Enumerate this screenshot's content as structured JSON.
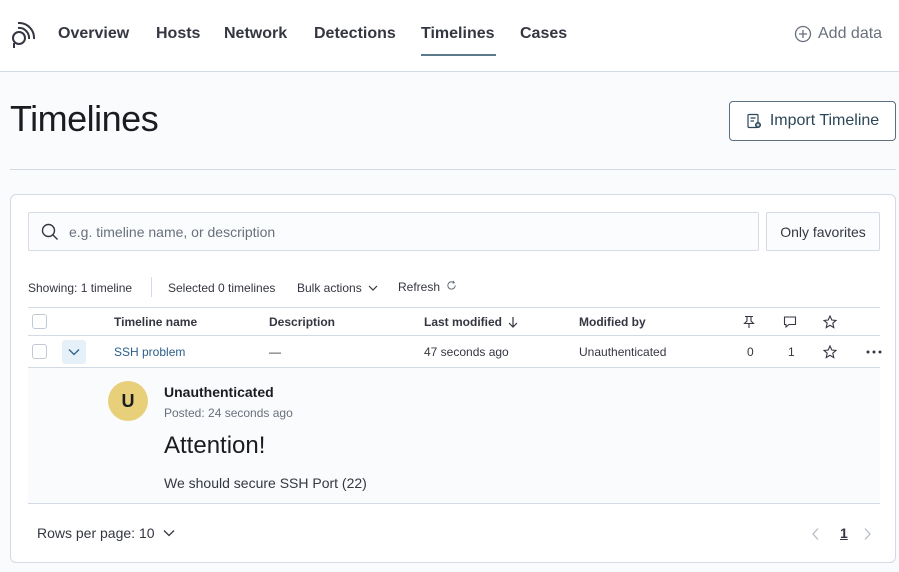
{
  "nav": {
    "tabs": [
      {
        "label": "Overview"
      },
      {
        "label": "Hosts"
      },
      {
        "label": "Network"
      },
      {
        "label": "Detections"
      },
      {
        "label": "Timelines",
        "active": true
      },
      {
        "label": "Cases"
      }
    ],
    "add_data_label": "Add data"
  },
  "header": {
    "title": "Timelines",
    "import_label": "Import Timeline"
  },
  "search": {
    "placeholder": "e.g. timeline name, or description",
    "value": "",
    "favorites_label": "Only favorites"
  },
  "utility_bar": {
    "showing": "Showing: 1 timeline",
    "selected": "Selected 0 timelines",
    "bulk_actions": "Bulk actions",
    "refresh": "Refresh"
  },
  "table": {
    "columns": {
      "name": "Timeline name",
      "description": "Description",
      "last_modified": "Last modified",
      "modified_by": "Modified by"
    },
    "rows": [
      {
        "name": "SSH problem",
        "description": "—",
        "last_modified": "47 seconds ago",
        "modified_by": "Unauthenticated",
        "pinned_count": "0",
        "notes_count": "1"
      }
    ]
  },
  "note": {
    "avatar_initial": "U",
    "user": "Unauthenticated",
    "posted": "Posted: 24 seconds ago",
    "heading": "Attention!",
    "body": "We should secure SSH Port (22)"
  },
  "pagination": {
    "rows_per_page": "Rows per page: 10",
    "current_page": "1"
  },
  "colors": {
    "accent": "#5c7a8a",
    "link": "#2b5f8a",
    "avatar": "#e8d07a"
  }
}
